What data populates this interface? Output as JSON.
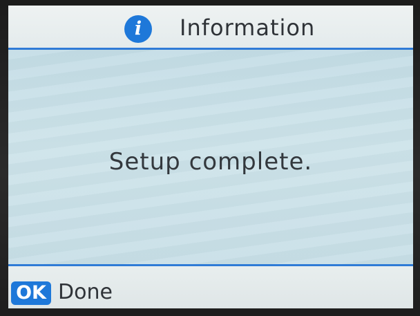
{
  "header": {
    "icon": "info-icon",
    "icon_glyph": "i",
    "title": "Information"
  },
  "main": {
    "message": "Setup complete."
  },
  "footer": {
    "ok_key_label": "OK",
    "action_label": "Done"
  },
  "colors": {
    "accent": "#1e78d9",
    "divider": "#2f7bd6",
    "content_bg": "#c8dfe7",
    "bar_bg": "#e6ecec"
  }
}
